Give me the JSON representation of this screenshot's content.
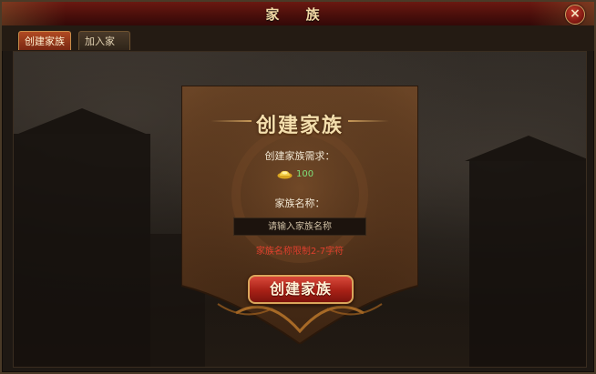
{
  "window": {
    "title": "家 族",
    "close_label": "×"
  },
  "tabs": [
    {
      "label": "创建家族",
      "active": true
    },
    {
      "label": "加入家族",
      "active": false
    }
  ],
  "panel": {
    "heading": "创建家族",
    "requirement_label": "创建家族需求：",
    "cost_value": "100",
    "cost_icon": "gold-ingot-icon",
    "name_label": "家族名称：",
    "name_placeholder": "请输入家族名称",
    "name_value": "",
    "limit_note": "家族名称限制2-7字符",
    "create_button_label": "创建家族"
  },
  "colors": {
    "title_bar": "#5a130d",
    "accent_gold": "#d8a65c",
    "cost_green": "#7fe07a",
    "warning_red": "#e0402d",
    "button_red": "#a72016"
  }
}
